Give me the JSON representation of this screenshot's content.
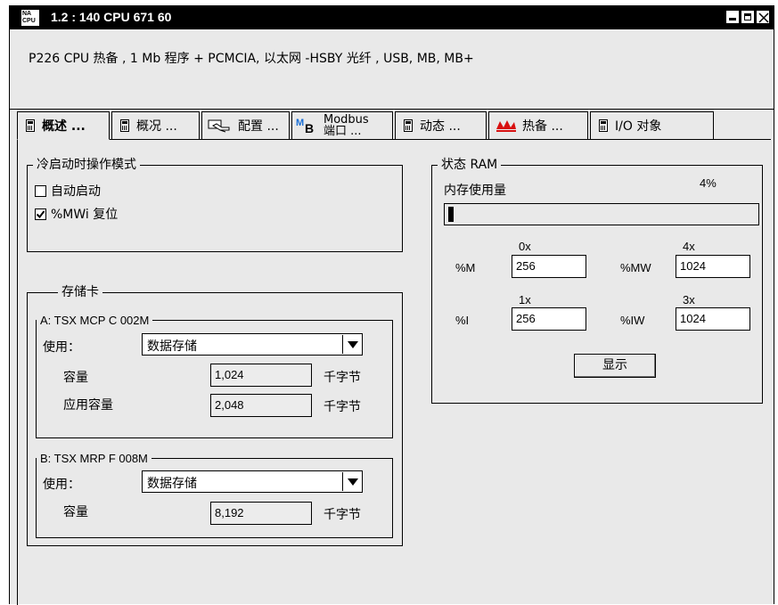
{
  "window": {
    "app_icon_top": "NA",
    "app_icon_bottom": "CPU",
    "title": "1.2 : 140 CPU 671 60"
  },
  "description": "P226 CPU 热备 , 1 Mb 程序 + PCMCIA, 以太网 -HSBY 光纤 , USB, MB, MB+",
  "tabs": [
    {
      "label": "概述 ..."
    },
    {
      "label": "概况 ..."
    },
    {
      "label": "配置 ..."
    },
    {
      "label_top": "Modbus",
      "label_bottom": "端口 ..."
    },
    {
      "label": "动态 ..."
    },
    {
      "label": "热备 ..."
    },
    {
      "label": "I/O 对象"
    }
  ],
  "cold_start": {
    "title": "冷启动时操作模式",
    "auto_start": {
      "label": "自动启动",
      "checked": false
    },
    "mwi_reset": {
      "label": "%MWi 复位",
      "checked": true
    }
  },
  "memory_card": {
    "title": "存储卡",
    "card_a": {
      "title": "A: TSX MCP C 002M",
      "use_label": "使用：",
      "use_value": "数据存储",
      "capacity_label": "容量",
      "capacity_value": "1,024",
      "capacity_unit": "千字节",
      "app_capacity_label": "应用容量",
      "app_capacity_value": "2,048",
      "app_capacity_unit": "千字节"
    },
    "card_b": {
      "title": "B: TSX MRP F 008M",
      "use_label": "使用：",
      "use_value": "数据存储",
      "capacity_label": "容量",
      "capacity_value": "8,192",
      "capacity_unit": "千字节"
    }
  },
  "status_ram": {
    "title": "状态 RAM",
    "memory_usage_label": "内存使用量",
    "memory_usage_percent": "4%",
    "memory_usage_fraction": 0.04,
    "m_label": "%M",
    "m_offset": "0x",
    "m_value": "256",
    "mw_label": "%MW",
    "mw_offset": "4x",
    "mw_value": "1024",
    "i_label": "%I",
    "i_offset": "1x",
    "i_value": "256",
    "iw_label": "%IW",
    "iw_offset": "3x",
    "iw_value": "1024",
    "show_button": "显示"
  }
}
